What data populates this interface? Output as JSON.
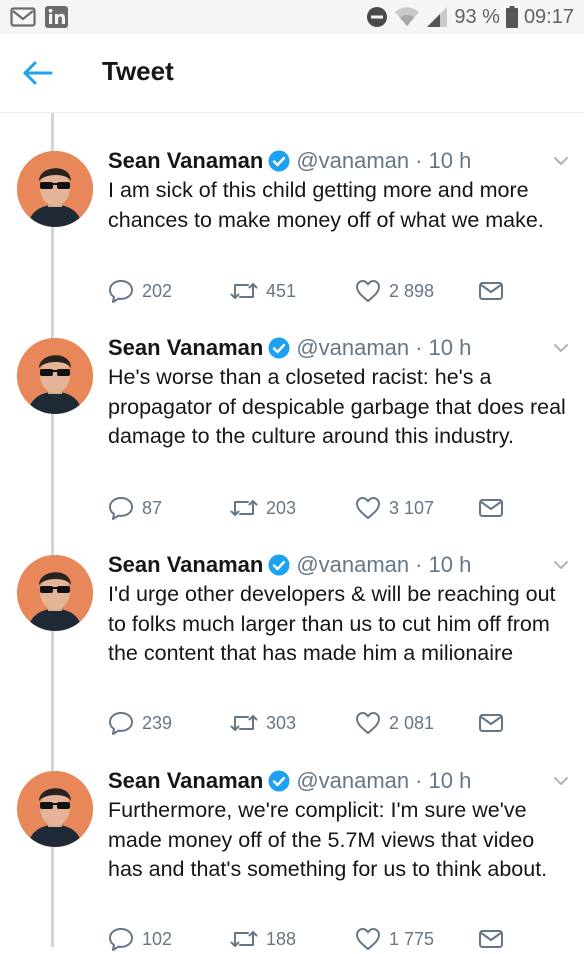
{
  "status_bar": {
    "battery": "93 %",
    "time": "09:17"
  },
  "header": {
    "title": "Tweet"
  },
  "tweets": [
    {
      "name": "Sean Vanaman",
      "handle": "@vanaman",
      "separator": "·",
      "time": "10 h",
      "text": "I am sick of this child getting more and more chances to make money off of what we make.",
      "replies": "202",
      "retweets": "451",
      "likes": "2 898"
    },
    {
      "name": "Sean Vanaman",
      "handle": "@vanaman",
      "separator": "·",
      "time": "10 h",
      "text": "He's worse than a closeted racist: he's a propagator of despicable garbage that does real damage to the culture around this industry.",
      "replies": "87",
      "retweets": "203",
      "likes": "3 107"
    },
    {
      "name": "Sean Vanaman",
      "handle": "@vanaman",
      "separator": "·",
      "time": "10 h",
      "text": "I'd urge other developers & will be reaching out to folks much larger than us to cut him off from the content that has made him a milionaire",
      "replies": "239",
      "retweets": "303",
      "likes": "2 081"
    },
    {
      "name": "Sean Vanaman",
      "handle": "@vanaman",
      "separator": "·",
      "time": "10 h",
      "text": "Furthermore, we're complicit: I'm sure we've made money off of the 5.7M views that video has and that's something for us to think about.",
      "replies": "102",
      "retweets": "188",
      "likes": "1 775"
    }
  ],
  "icons": {
    "status_left": [
      "gmail-icon",
      "linkedin-icon"
    ],
    "status_right": [
      "do-not-disturb-icon",
      "wifi-icon",
      "signal-icon",
      "battery-icon"
    ],
    "tweet": [
      "verified-icon",
      "chevron-down-icon",
      "reply-icon",
      "retweet-icon",
      "heart-icon",
      "mail-icon"
    ]
  },
  "colors": {
    "accent": "#1da1f2",
    "text": "#14171a",
    "muted": "#657786",
    "thread_line": "#ccd6dd"
  }
}
